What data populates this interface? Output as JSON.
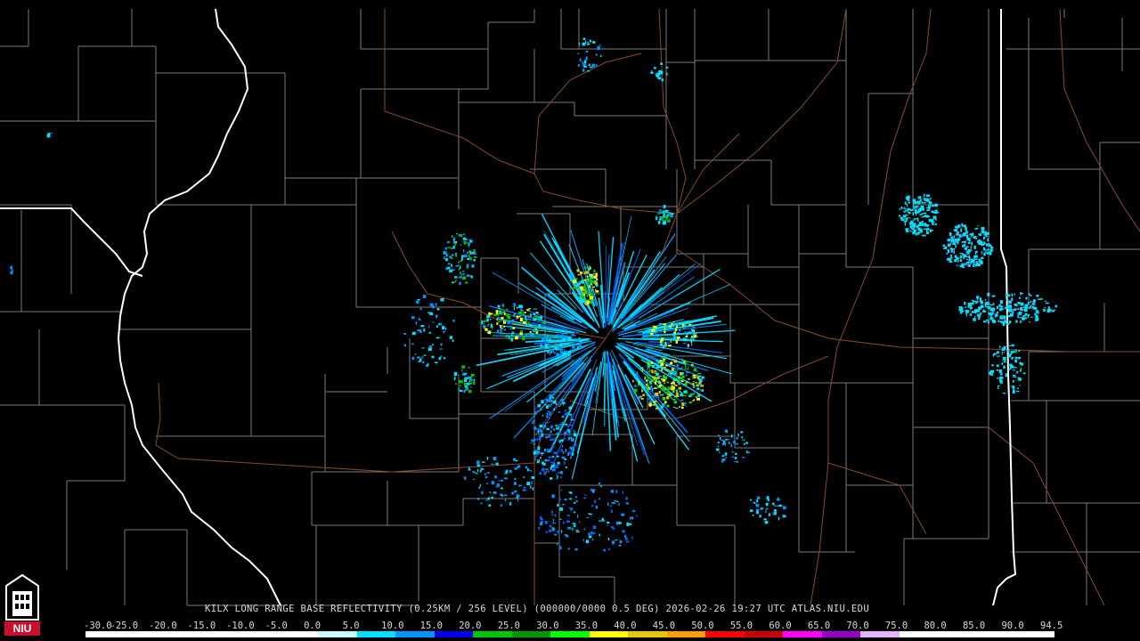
{
  "product": {
    "caption": "KILX LONG RANGE BASE REFLECTIVITY (0.25KM / 256 LEVEL) (000000/0000 0.5 DEG) 2026-02-26 19:27 UTC  ATLAS.NIU.EDU"
  },
  "logo": {
    "label": "NIU",
    "color": "#c8102e"
  },
  "scale": {
    "labels": [
      "-30.0",
      "-25.0",
      "-20.0",
      "-15.0",
      "-10.0",
      "-5.0",
      "0.0",
      "5.0",
      "10.0",
      "15.0",
      "20.0",
      "25.0",
      "30.0",
      "35.0",
      "40.0",
      "45.0",
      "50.0",
      "55.0",
      "60.0",
      "65.0",
      "70.0",
      "75.0",
      "80.0",
      "85.0",
      "90.0",
      "94.5"
    ],
    "colors": [
      "#ffffff",
      "#ffffff",
      "#ffffff",
      "#ffffff",
      "#ffffff",
      "#ffffff",
      "#c8ffff",
      "#00e0ff",
      "#0096ff",
      "#0000f0",
      "#00c800",
      "#009600",
      "#00ff00",
      "#ffff00",
      "#e6c800",
      "#ffa000",
      "#ff0000",
      "#c80000",
      "#ff00ff",
      "#9600c8",
      "#e6b4ff",
      "#ffffff",
      "#ffffff",
      "#ffffff",
      "#ffffff"
    ]
  },
  "map_colors": {
    "background": "#000000",
    "county_lines": "#7a7a7a",
    "state_lines": "#ffffff",
    "highways": "#8a4a2a"
  }
}
